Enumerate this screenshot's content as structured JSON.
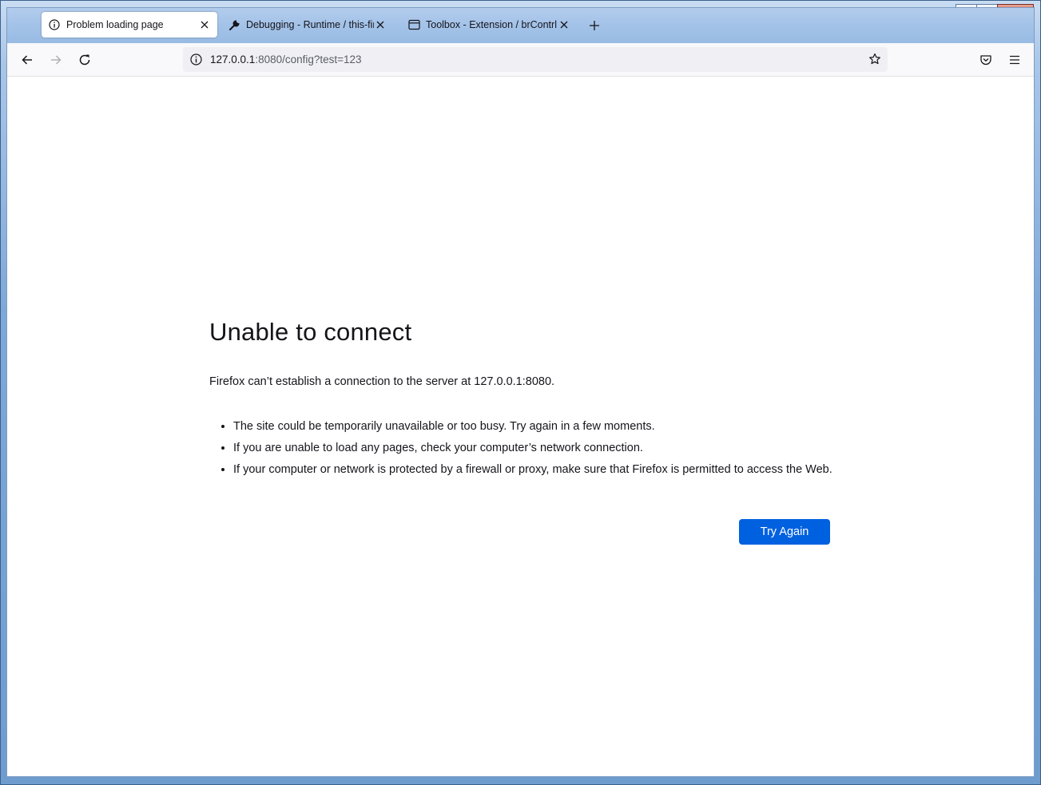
{
  "window": {
    "caption_buttons": [
      "minimize",
      "maximize",
      "close"
    ]
  },
  "tabs": [
    {
      "label": "Problem loading page",
      "icon": "info-icon",
      "active": true
    },
    {
      "label": "Debugging - Runtime / this-fire",
      "icon": "wrench-icon",
      "active": false
    },
    {
      "label": "Toolbox - Extension / brContrl",
      "icon": "window-icon",
      "active": false
    }
  ],
  "navbar": {
    "url_host": "127.0.0.1",
    "url_rest": ":8080/config?test=123"
  },
  "error": {
    "title": "Unable to connect",
    "description": "Firefox can’t establish a connection to the server at 127.0.0.1:8080.",
    "bullets": [
      "The site could be temporarily unavailable or too busy. Try again in a few moments.",
      "If you are unable to load any pages, check your computer’s network connection.",
      "If your computer or network is protected by a firewall or proxy, make sure that Firefox is permitted to access the Web."
    ],
    "button_label": "Try Again"
  },
  "colors": {
    "accent": "#0061e0",
    "text": "#15141a"
  }
}
